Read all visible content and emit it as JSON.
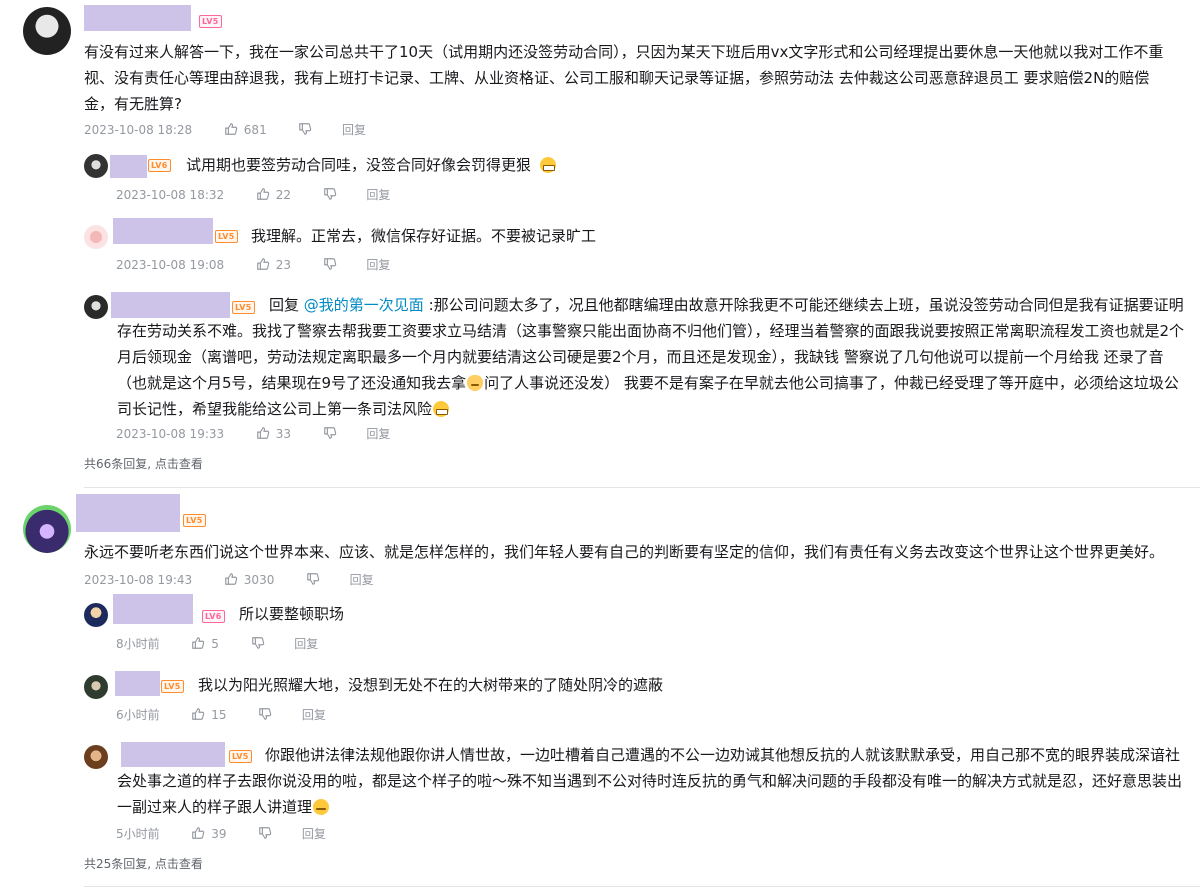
{
  "comments": [
    {
      "text": "有没有过来人解答一下，我在一家公司总共干了10天（试用期内还没签劳动合同），只因为某天下班后用vx文字形式和公司经理提出要休息一天他就以我对工作不重视、没有责任心等理由辞退我，我有上班打卡记录、工牌、从业资格证、公司工服和聊天记录等证据，参照劳动法 去仲裁这公司恶意辞退员工 要求赔偿2N的赔偿金，有无胜算?",
      "time": "2023-10-08 18:28",
      "likes": "681",
      "reply_label": "回复",
      "level": "LV5",
      "replies": [
        {
          "text": "试用期也要签劳动合同哇，没签合同好像会罚得更狠",
          "time": "2023-10-08 18:32",
          "likes": "22",
          "reply_label": "回复",
          "level": "LV6"
        },
        {
          "text": "我理解。正常去，微信保存好证据。不要被记录旷工",
          "time": "2023-10-08 19:08",
          "likes": "23",
          "reply_label": "回复",
          "level": "LV5"
        },
        {
          "prefix": "回复 ",
          "mention": "@我的第一次见面",
          "text": " :那公司问题太多了，况且他都瞎编理由故意开除我更不可能还继续去上班，虽说没签劳动合同但是我有证据要证明存在劳动关系不难。我找了警察去帮我要工资要求立马结清（这事警察只能出面协商不归他们管），经理当着警察的面跟我说要按照正常离职流程发工资也就是2个月后领现金（离谱吧，劳动法规定离职最多一个月内就要结清这公司硬是要2个月，而且还是发现金），我缺钱 警察说了几句他说可以提前一个月给我 还录了音（也就是这个月5号，结果现在9号了还没通知我去拿",
          "text2": "问了人事说还没发） 我要不是有案子在早就去他公司搞事了，仲裁已经受理了等开庭中，必须给这垃圾公司长记性，希望我能给这公司上第一条司法风险",
          "time": "2023-10-08 19:33",
          "likes": "33",
          "reply_label": "回复",
          "level": "LV5"
        }
      ],
      "more": "共66条回复, 点击查看"
    },
    {
      "text": "永远不要听老东西们说这个世界本来、应该、就是怎样怎样的，我们年轻人要有自己的判断要有坚定的信仰，我们有责任有义务去改变这个世界让这个世界更美好。",
      "time": "2023-10-08 19:43",
      "likes": "3030",
      "reply_label": "回复",
      "level": "LV5",
      "replies": [
        {
          "text": "所以要整顿职场",
          "time": "8小时前",
          "likes": "5",
          "reply_label": "回复",
          "level": "LV6"
        },
        {
          "text": "我以为阳光照耀大地，没想到无处不在的大树带来的了随处阴冷的遮蔽",
          "time": "6小时前",
          "likes": "15",
          "reply_label": "回复",
          "level": "LV5"
        },
        {
          "text": "你跟他讲法律法规他跟你讲人情世故，一边吐槽着自己遭遇的不公一边劝诫其他想反抗的人就该默默承受，用自己那不宽的眼界装成深谙社会处事之道的样子去跟你说没用的啦，都是这个样子的啦～殊不知当遇到不公对待时连反抗的勇气和解决问题的手段都没有唯一的解决方式就是忍，还好意思装出一副过来人的样子跟人讲道理",
          "time": "5小时前",
          "likes": "39",
          "reply_label": "回复",
          "level": "LV5"
        }
      ],
      "more": "共25条回复, 点击查看"
    }
  ],
  "colors": {
    "level_pink": "#ff6699",
    "level_orange": "#ff8c2e",
    "mention": "#008ac5",
    "meta": "#9499a0"
  },
  "icons": [
    "like-icon",
    "dislike-icon",
    "grin-emoji",
    "cat-emoji",
    "shy-emoji"
  ]
}
